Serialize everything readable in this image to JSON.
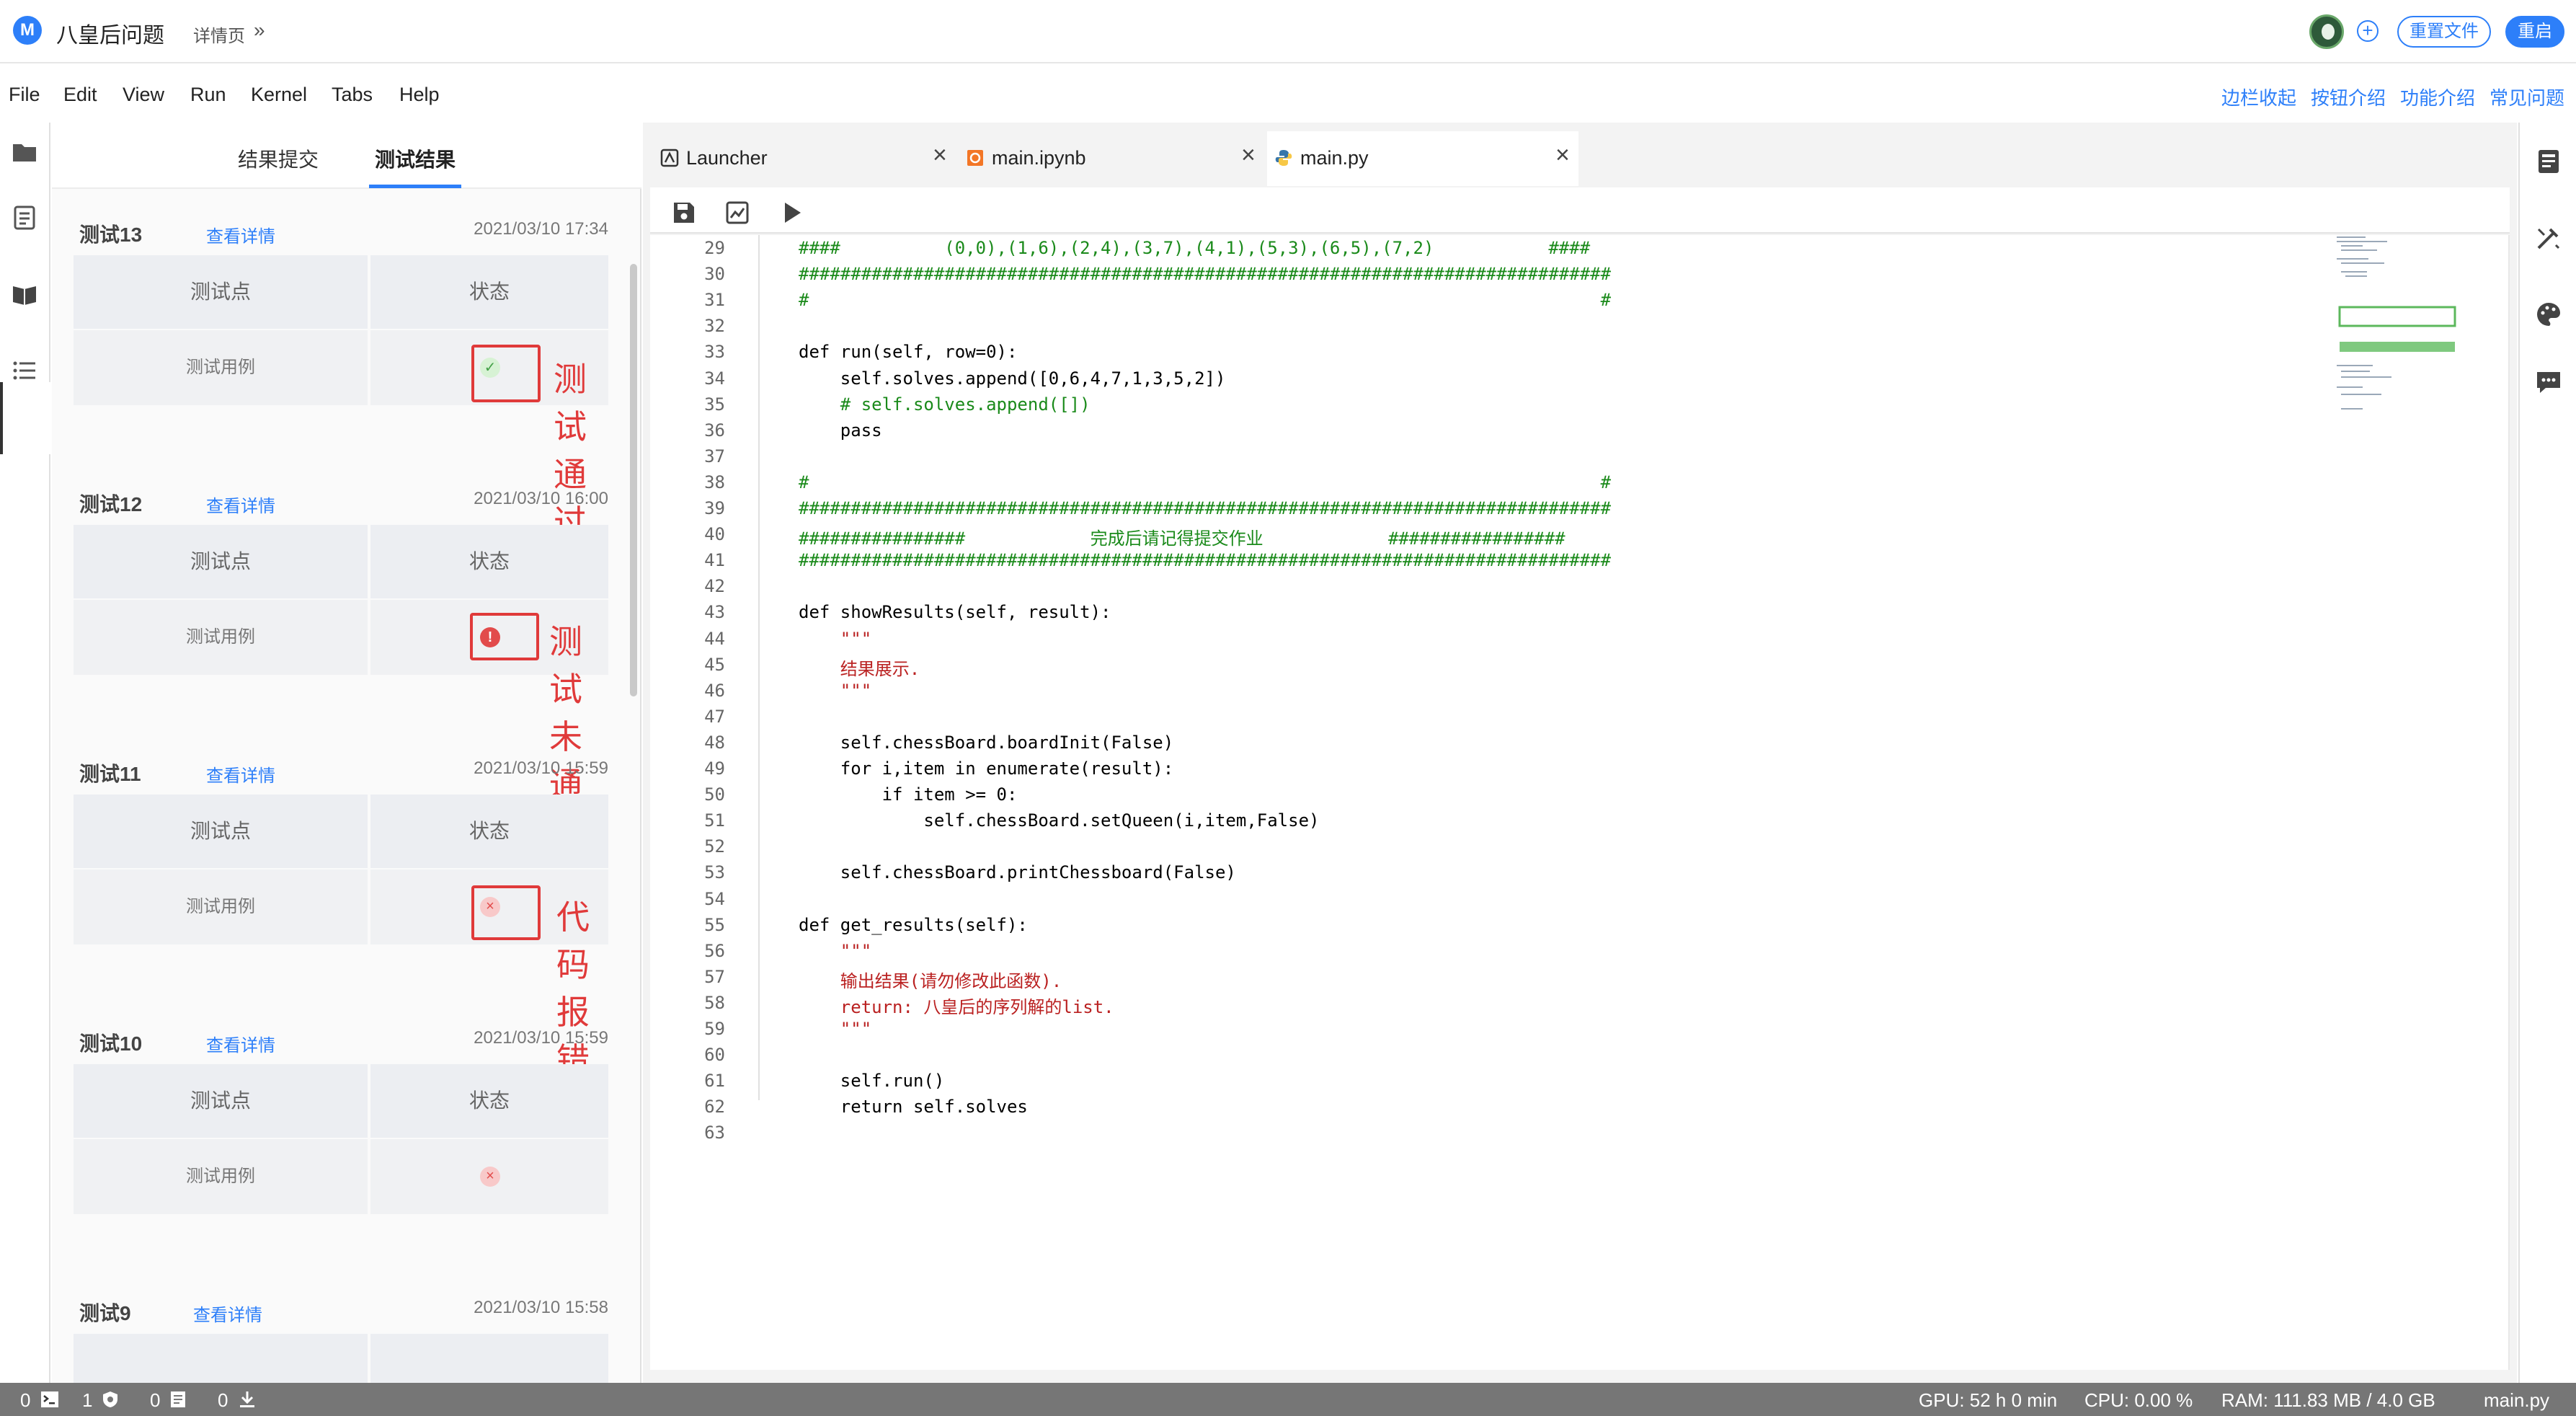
{
  "header": {
    "logo_letter": "M",
    "title": "八皇后问题",
    "breadcrumb": "详情页",
    "breadcrumb_chevron": "»",
    "plus_glyph": "+",
    "reset_file": "重置文件",
    "restart": "重启"
  },
  "menu": {
    "items": [
      "File",
      "Edit",
      "View",
      "Run",
      "Kernel",
      "Tabs",
      "Help"
    ],
    "right_links": [
      "边栏收起",
      "按钮介绍",
      "功能介绍",
      "常见问题"
    ]
  },
  "left_panel": {
    "tabs": [
      "结果提交",
      "测试结果"
    ],
    "active_tab": "测试结果",
    "col_point": "测试点",
    "col_status": "状态",
    "row_case": "测试用例",
    "detail_label": "查看详情",
    "tests": [
      {
        "name": "测试13",
        "date": "2021/03/10 17:34",
        "status": "pass",
        "annotation": "测试通过"
      },
      {
        "name": "测试12",
        "date": "2021/03/10 16:00",
        "status": "fail",
        "annotation": "测试未通过"
      },
      {
        "name": "测试11",
        "date": "2021/03/10 15:59",
        "status": "error",
        "annotation": "代码报错"
      },
      {
        "name": "测试10",
        "date": "2021/03/10 15:59",
        "status": "error",
        "annotation": ""
      },
      {
        "name": "测试9",
        "date": "2021/03/10 15:58",
        "status": "",
        "annotation": ""
      }
    ]
  },
  "editor": {
    "tabs": [
      {
        "label": "Launcher",
        "icon": "launcher-icon"
      },
      {
        "label": "main.ipynb",
        "icon": "notebook-icon"
      },
      {
        "label": "main.py",
        "icon": "python-icon"
      }
    ],
    "active_tab": "main.py",
    "close_glyph": "×",
    "lines": [
      {
        "n": "29",
        "t": "####          (0,0),(1,6),(2,4),(3,7),(4,1),(5,3),(6,5),(7,2)           ####"
      },
      {
        "n": "30",
        "t": "##############################################################################"
      },
      {
        "n": "31",
        "t": "#                                                                            #"
      },
      {
        "n": "32",
        "t": ""
      },
      {
        "n": "33",
        "t": "def run(self, row=0):"
      },
      {
        "n": "34",
        "t": "    self.solves.append([0,6,4,7,1,3,5,2])"
      },
      {
        "n": "35",
        "t": "    # self.solves.append([])"
      },
      {
        "n": "36",
        "t": "    pass"
      },
      {
        "n": "37",
        "t": ""
      },
      {
        "n": "38",
        "t": "#                                                                            #"
      },
      {
        "n": "39",
        "t": "##############################################################################"
      },
      {
        "n": "40",
        "t": "################            完成后请记得提交作业            #################"
      },
      {
        "n": "41",
        "t": "##############################################################################"
      },
      {
        "n": "42",
        "t": ""
      },
      {
        "n": "43",
        "t": "def showResults(self, result):"
      },
      {
        "n": "44",
        "t": "    \"\"\""
      },
      {
        "n": "45",
        "t": "    结果展示."
      },
      {
        "n": "46",
        "t": "    \"\"\""
      },
      {
        "n": "47",
        "t": ""
      },
      {
        "n": "48",
        "t": "    self.chessBoard.boardInit(False)"
      },
      {
        "n": "49",
        "t": "    for i,item in enumerate(result):"
      },
      {
        "n": "50",
        "t": "        if item >= 0:"
      },
      {
        "n": "51",
        "t": "            self.chessBoard.setQueen(i,item,False)"
      },
      {
        "n": "52",
        "t": ""
      },
      {
        "n": "53",
        "t": "    self.chessBoard.printChessboard(False)"
      },
      {
        "n": "54",
        "t": ""
      },
      {
        "n": "55",
        "t": "def get_results(self):"
      },
      {
        "n": "56",
        "t": "    \"\"\""
      },
      {
        "n": "57",
        "t": "    输出结果(请勿修改此函数)."
      },
      {
        "n": "58",
        "t": "    return: 八皇后的序列解的list."
      },
      {
        "n": "59",
        "t": "    \"\"\""
      },
      {
        "n": "60",
        "t": ""
      },
      {
        "n": "61",
        "t": "    self.run()"
      },
      {
        "n": "62",
        "t": "    return self.solves"
      },
      {
        "n": "63",
        "t": ""
      }
    ]
  },
  "statusbar": {
    "terminals": "0",
    "kernels": "1",
    "docs": "0",
    "downloads": "0",
    "gpu": "GPU: 52 h 0 min",
    "cpu": "CPU: 0.00 %",
    "ram": "RAM: 111.83 MB / 4.0 GB",
    "file": "main.py"
  },
  "colors": {
    "accent": "#2d7ff9",
    "annotation": "#e03a3a",
    "comment": "#408080",
    "keyword": "#008000",
    "string": "#ba2121"
  }
}
